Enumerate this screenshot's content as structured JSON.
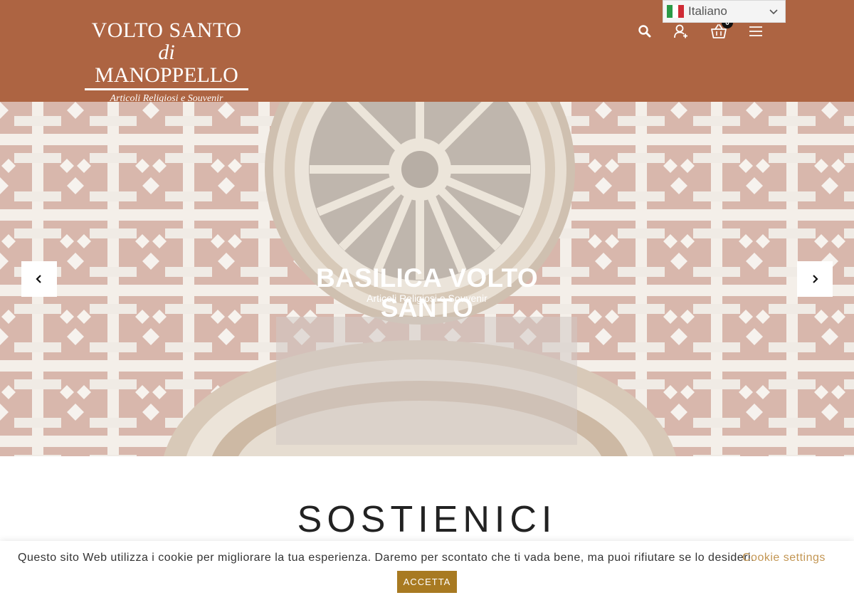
{
  "header": {
    "logo": {
      "line1": "VOLTO SANTO",
      "line2_prefix": "di",
      "line2_main": "MANOPPELLO",
      "line3": "Articoli Religiosi e Souvenir"
    },
    "cart_count": "0",
    "icons": [
      "search-icon",
      "user-add-icon",
      "cart-icon",
      "menu-icon"
    ],
    "colors": {
      "background": "#ad6442"
    }
  },
  "language": {
    "selected": "Italiano",
    "flag": "italy-flag-icon"
  },
  "hero": {
    "title": "BASILICA VOLTO SANTO",
    "subtitle": "Articoli Religiosi e Souvenir",
    "prev_icon": "chevron-left-icon",
    "next_icon": "chevron-right-icon"
  },
  "section": {
    "title": "SOSTIENICI"
  },
  "cookie": {
    "text": "Questo sito Web utilizza i cookie per migliorare la tua esperienza. Daremo per scontato che ti vada bene, ma puoi rifiutare se lo desideri.",
    "settings_label": "Cookie settings",
    "accept_label": "ACCETTA",
    "colors": {
      "link": "#c39653",
      "button": "#a87a22"
    }
  }
}
